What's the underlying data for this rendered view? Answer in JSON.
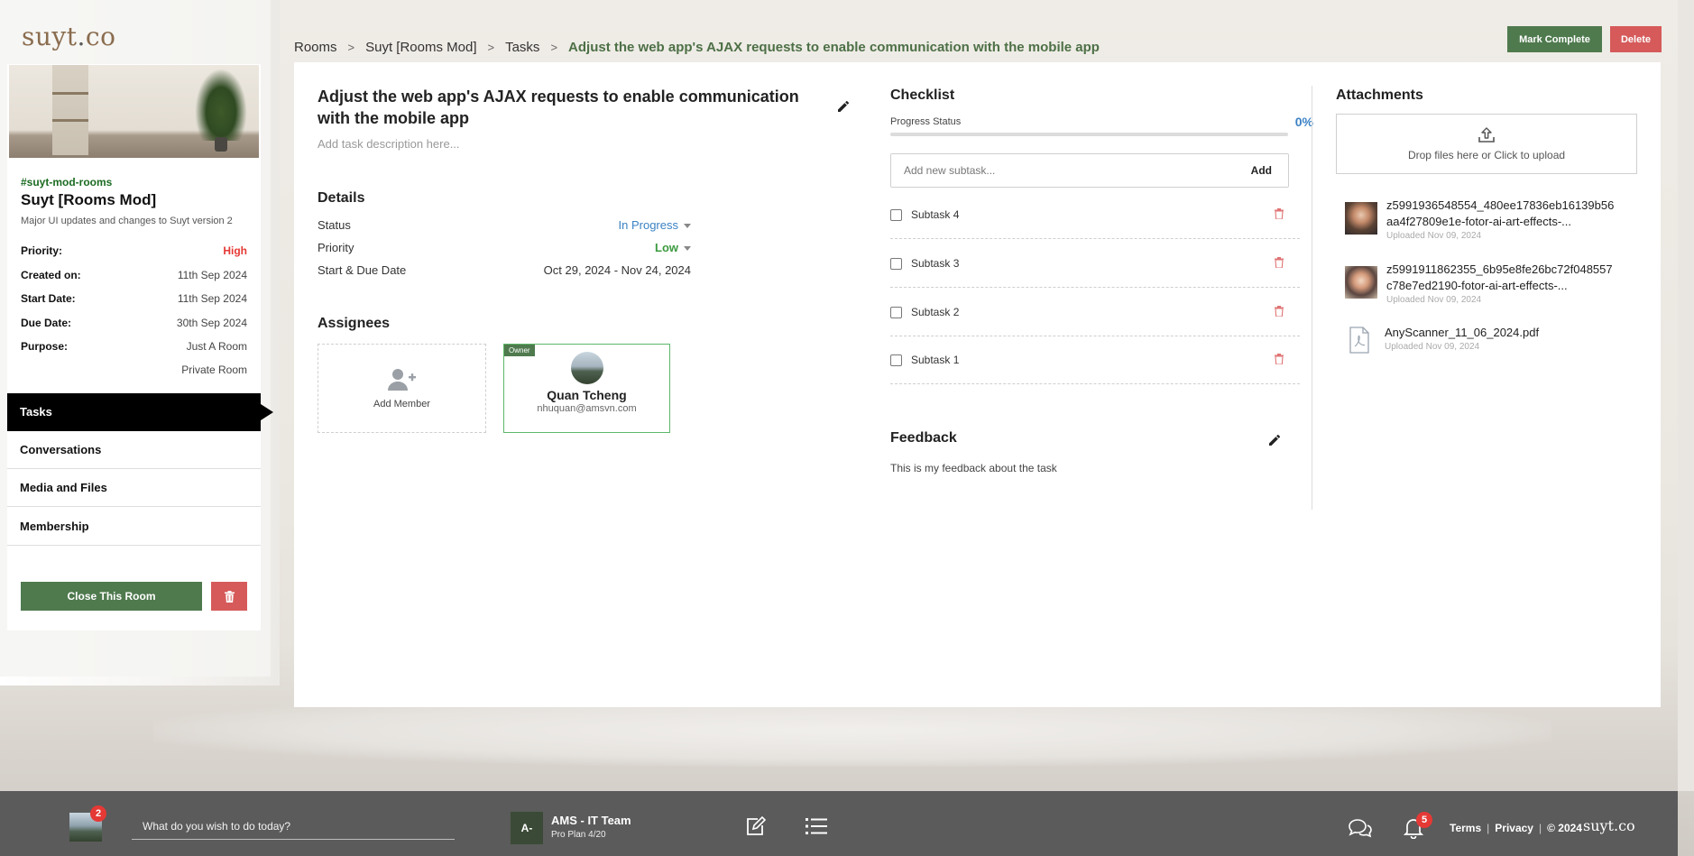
{
  "brand": {
    "logo_main": "suyt",
    "logo_dot": ".",
    "logo_end": "co"
  },
  "room": {
    "tag": "#suyt-mod-rooms",
    "name": "Suyt [Rooms Mod]",
    "description": "Major UI updates and changes to Suyt version 2",
    "info": [
      {
        "label": "Priority:",
        "value": "High"
      },
      {
        "label": "Created on:",
        "value": "11th Sep 2024"
      },
      {
        "label": "Start Date:",
        "value": "11th Sep 2024"
      },
      {
        "label": "Due Date:",
        "value": "30th Sep 2024"
      },
      {
        "label": "Purpose:",
        "value": "Just A Room"
      },
      {
        "label": "",
        "value": "Private Room"
      }
    ],
    "nav": [
      "Tasks",
      "Conversations",
      "Media and Files",
      "Membership"
    ],
    "close_label": "Close This Room"
  },
  "breadcrumb": [
    "Rooms",
    "Suyt [Rooms Mod]",
    "Tasks",
    "Adjust the web app's AJAX requests to enable communication with the mobile app"
  ],
  "actions": {
    "complete_label": "Mark Complete",
    "delete_label": "Delete"
  },
  "task": {
    "title": "Adjust the web app's AJAX requests to enable communication with the mobile app",
    "description_placeholder": "Add task description here...",
    "details_heading": "Details",
    "details": {
      "status_label": "Status",
      "status_value": "In Progress",
      "priority_label": "Priority",
      "priority_value": "Low",
      "dates_label": "Start & Due Date",
      "dates_value": "Oct 29, 2024 - Nov 24, 2024"
    },
    "assignees_heading": "Assignees",
    "add_member_label": "Add Member",
    "member": {
      "badge": "Owner",
      "name": "Quan Tcheng",
      "email": "nhuquan@amsvn.com"
    }
  },
  "checklist": {
    "heading": "Checklist",
    "progress_label": "Progress Status",
    "progress_text": "0%",
    "progress_fraction": 0,
    "input_placeholder": "Add new subtask...",
    "add_label": "Add",
    "items": [
      "Subtask 4",
      "Subtask 3",
      "Subtask 2",
      "Subtask 1"
    ]
  },
  "feedback": {
    "heading": "Feedback",
    "text": "This is my feedback about the task"
  },
  "attachments": {
    "heading": "Attachments",
    "upload_label": "Drop files here or Click to upload",
    "files": [
      {
        "name_line1": "z5991936548554_480ee17836eb16139b56",
        "name_line2": "aa4f27809e1e-fotor-ai-art-effects-...",
        "date": "Uploaded Nov 09, 2024",
        "kind": "image"
      },
      {
        "name_line1": "z5991911862355_6b95e8fe26bc72f048557",
        "name_line2": "c78e7ed2190-fotor-ai-art-effects-...",
        "date": "Uploaded Nov 09, 2024",
        "kind": "image"
      },
      {
        "name_line1": "AnyScanner_11_06_2024.pdf",
        "name_line2": "",
        "date": "Uploaded Nov 09, 2024",
        "kind": "pdf"
      }
    ]
  },
  "bottom": {
    "avatar_badge": "2",
    "search_placeholder": "What do you wish to do today?",
    "team_initial": "A-",
    "team_name": "AMS - IT Team",
    "team_plan": "Pro Plan 4/20",
    "notif_badge": "5",
    "terms": "Terms",
    "privacy": "Privacy",
    "copyright": "© 2024",
    "logo": "suyt.co"
  },
  "colors": {
    "accent_green": "#4f7a4e",
    "danger": "#d65a5a",
    "link_blue": "#3b82c4",
    "high_red": "#e53935"
  }
}
